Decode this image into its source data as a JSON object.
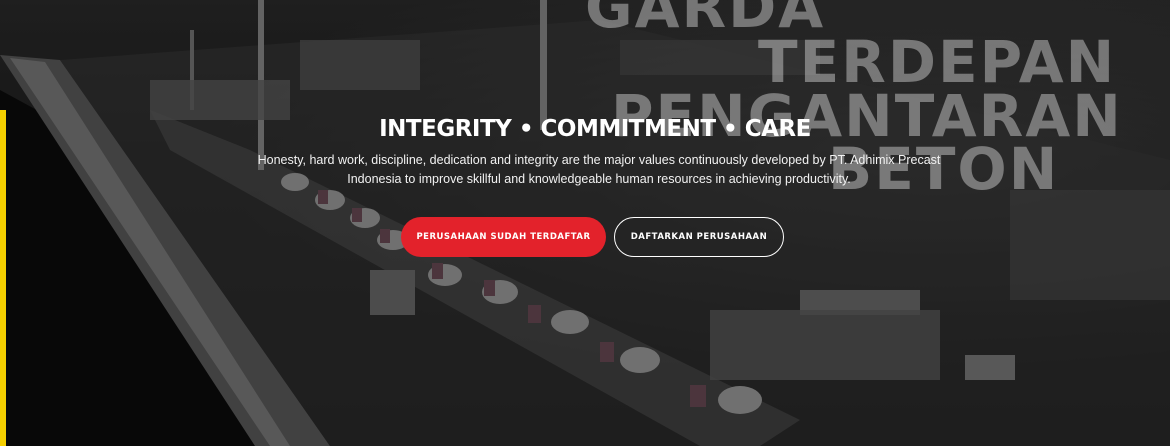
{
  "hero": {
    "watermark_lines": [
      "GARDA",
      "TERDEPAN",
      "PENGANTARAN",
      "BETON"
    ],
    "headline": "INTEGRITY • COMMITMENT • CARE",
    "description": "Honesty, hard work, discipline, dedication and integrity are the major values continuously developed by PT. Adhimix Precast Indonesia to improve skillful and knowledgeable human resources in achieving productivity.",
    "buttons": {
      "registered": "PERUSAHAAN SUDAH TERDAFTAR",
      "register": "DAFTARKAN PERUSAHAAN"
    }
  },
  "colors": {
    "accent": "#e3222b",
    "side_bar": "#f6d000"
  }
}
